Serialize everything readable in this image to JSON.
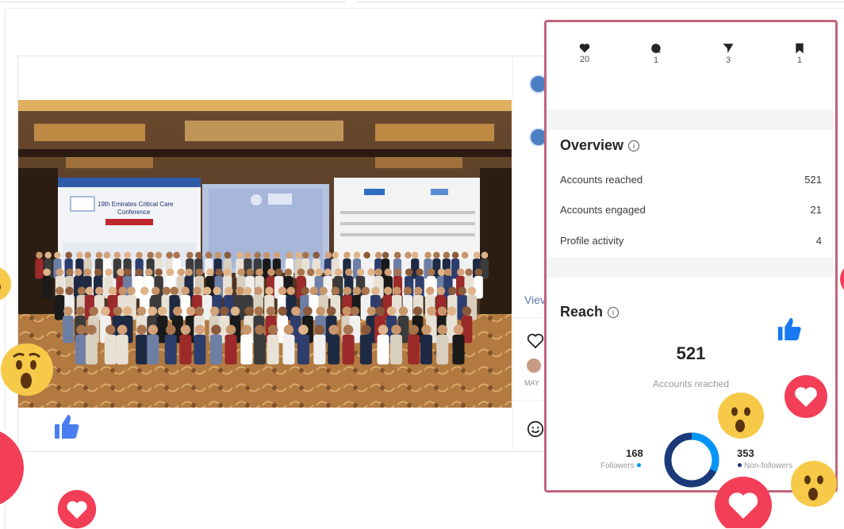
{
  "post": {
    "side": {
      "view_text": "Viev",
      "date_text": "MAY"
    }
  },
  "insights": {
    "stats": [
      {
        "icon": "heart-icon",
        "value": "20"
      },
      {
        "icon": "comment-icon",
        "value": "1"
      },
      {
        "icon": "share-icon",
        "value": "3"
      },
      {
        "icon": "bookmark-icon",
        "value": "1"
      }
    ],
    "overview": {
      "title": "Overview",
      "rows": [
        {
          "label": "Accounts reached",
          "value": "521"
        },
        {
          "label": "Accounts engaged",
          "value": "21"
        },
        {
          "label": "Profile activity",
          "value": "4"
        }
      ]
    },
    "reach": {
      "title": "Reach",
      "total": "521",
      "total_label": "Accounts reached",
      "followers": {
        "value": "168",
        "label": "Followers",
        "color": "#0095f6"
      },
      "non_followers": {
        "value": "353",
        "label": "Non-followers",
        "color": "#1a3a7a"
      },
      "follower_fraction": 0.322
    }
  },
  "colors": {
    "accent": "#c0657a",
    "reaction_red": "#f33e58",
    "like_blue": "#1877f2",
    "wow_yellow": "#f7c948"
  }
}
